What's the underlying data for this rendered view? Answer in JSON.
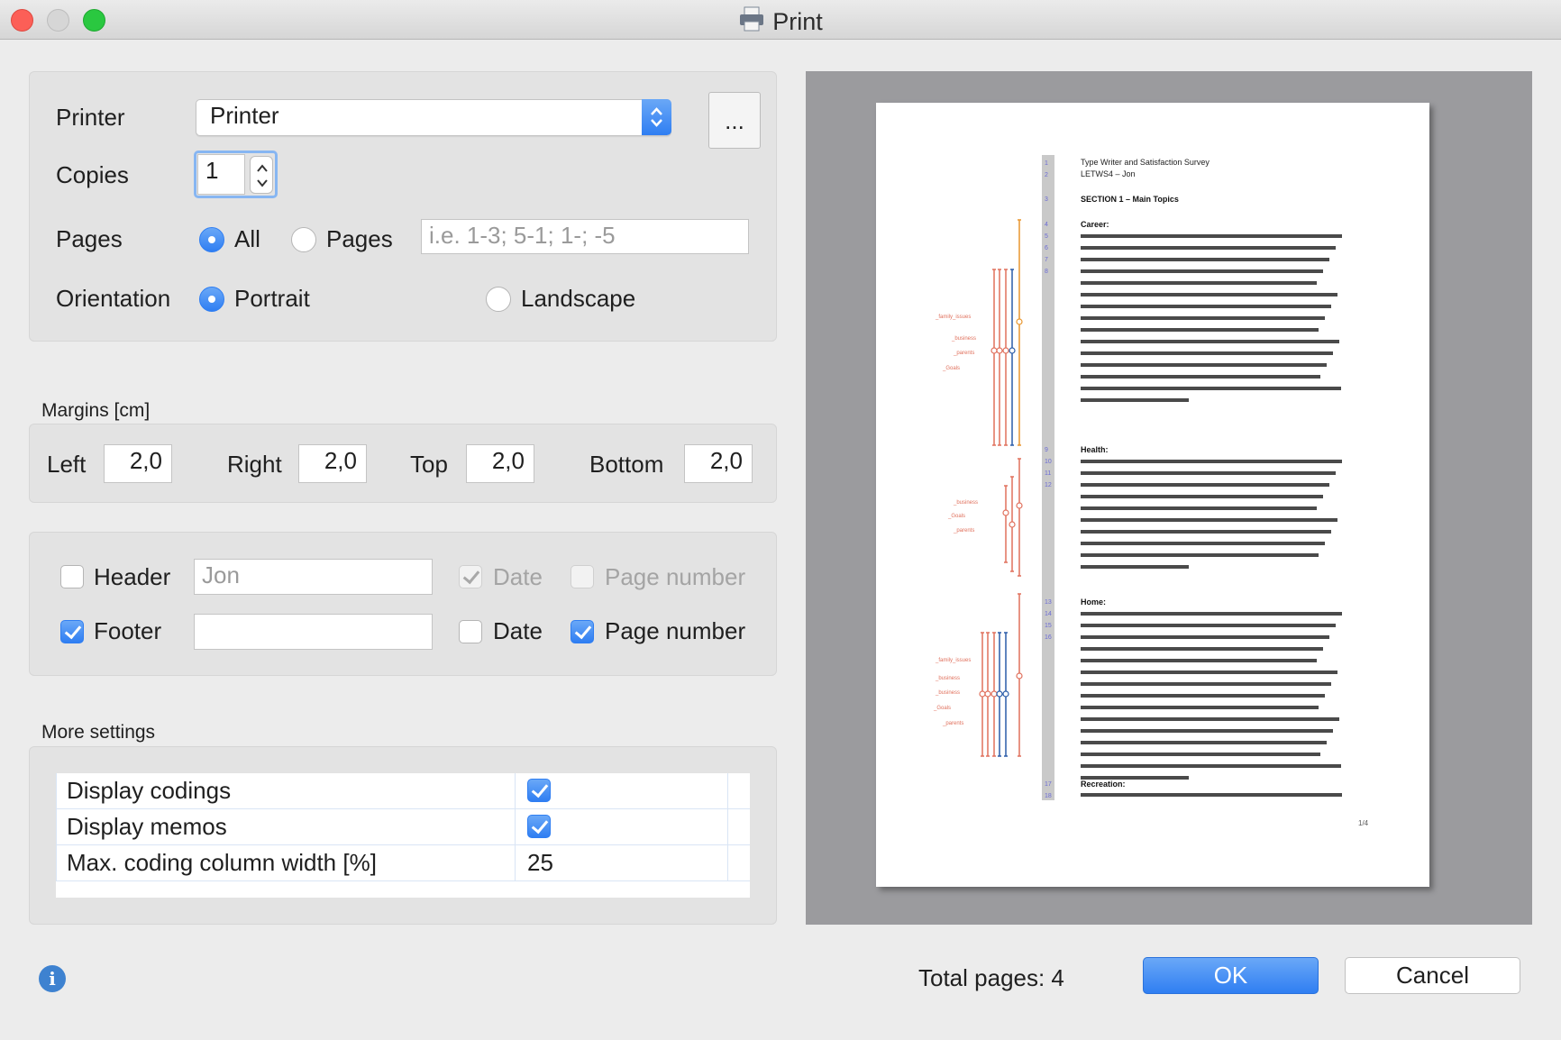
{
  "window": {
    "title": "Print"
  },
  "printer": {
    "label": "Printer",
    "value": "Printer",
    "more_button": "..."
  },
  "copies": {
    "label": "Copies",
    "value": "1"
  },
  "pages": {
    "label": "Pages",
    "all_label": "All",
    "range_label": "Pages",
    "range_placeholder": "i.e. 1-3; 5-1; 1-; -5",
    "selected": "All"
  },
  "orientation": {
    "label": "Orientation",
    "portrait_label": "Portrait",
    "landscape_label": "Landscape",
    "selected": "Portrait"
  },
  "margins": {
    "title": "Margins [cm]",
    "left_label": "Left",
    "left": "2,0",
    "right_label": "Right",
    "right": "2,0",
    "top_label": "Top",
    "top": "2,0",
    "bottom_label": "Bottom",
    "bottom": "2,0"
  },
  "header": {
    "label": "Header",
    "checked": false,
    "text_value": "Jon",
    "date_label": "Date",
    "date_checked": true,
    "page_number_label": "Page number",
    "page_number_checked": false
  },
  "footer": {
    "label": "Footer",
    "checked": true,
    "text_value": "",
    "date_label": "Date",
    "date_checked": false,
    "page_number_label": "Page number",
    "page_number_checked": true
  },
  "more_settings": {
    "title": "More settings",
    "rows": [
      {
        "name": "Display codings",
        "value": true
      },
      {
        "name": "Display memos",
        "value": true
      },
      {
        "name": "Max. coding column width [%]",
        "value": "25"
      }
    ]
  },
  "preview": {
    "page_indicator": "1/4",
    "doc_heading_1": "Type Writer and Satisfaction Survey",
    "doc_heading_2": "LETWS4 – Jon",
    "section_title": "SECTION 1 – Main Topics",
    "career_title": "Career:",
    "health_title": "Health:",
    "home_title": "Home:",
    "recreation_title": "Recreation:",
    "code_labels": [
      "_family_issues",
      "_business",
      "_parents",
      "_Goals"
    ]
  },
  "footer_bar": {
    "total_pages": "Total pages: 4",
    "ok_label": "OK",
    "cancel_label": "Cancel"
  },
  "colors": {
    "accent": "#2f7ef2",
    "preview_bg": "#9b9b9e",
    "code_red": "#e0705c",
    "code_orange": "#e8962e",
    "code_blue": "#2a5ca8"
  }
}
